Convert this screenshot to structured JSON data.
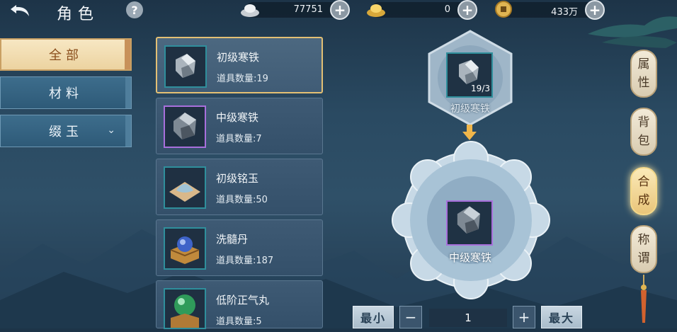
{
  "header": {
    "title": "角色",
    "help": "?"
  },
  "currency": [
    {
      "name": "silver-ingot",
      "value": "77751"
    },
    {
      "name": "gold-ingot",
      "value": "0"
    },
    {
      "name": "copper-coin",
      "value": "433万"
    }
  ],
  "plus": "+",
  "tabs": [
    {
      "label": "全部",
      "selected": true
    },
    {
      "label": "材料",
      "selected": false
    },
    {
      "label": "缀玉",
      "selected": false,
      "dropdown": true
    }
  ],
  "items": [
    {
      "name": "初级寒铁",
      "count": "道具数量:19",
      "icon": "iron-ore-icon",
      "selected": true
    },
    {
      "name": "中级寒铁",
      "count": "道具数量:7",
      "icon": "dark-iron-ore-icon"
    },
    {
      "name": "初级铭玉",
      "count": "道具数量:50",
      "icon": "jade-powder-icon"
    },
    {
      "name": "洗髓丹",
      "count": "道具数量:187",
      "icon": "pill-box-icon"
    },
    {
      "name": "低阶正气丸",
      "count": "道具数量:5",
      "icon": "green-pill-icon"
    }
  ],
  "synthesis": {
    "source": {
      "name": "初级寒铁",
      "count": "19/3"
    },
    "target": {
      "name": "中级寒铁"
    }
  },
  "quantity": {
    "min_label": "最小",
    "minus": "−",
    "value": "1",
    "plus": "+",
    "max_label": "最大"
  },
  "side_nav": [
    {
      "label": "属性",
      "chars": [
        "属",
        "性"
      ]
    },
    {
      "label": "背包",
      "chars": [
        "背",
        "包"
      ]
    },
    {
      "label": "合成",
      "chars": [
        "合",
        "成"
      ],
      "selected": true
    },
    {
      "label": "称谓",
      "chars": [
        "称",
        "谓"
      ]
    }
  ]
}
